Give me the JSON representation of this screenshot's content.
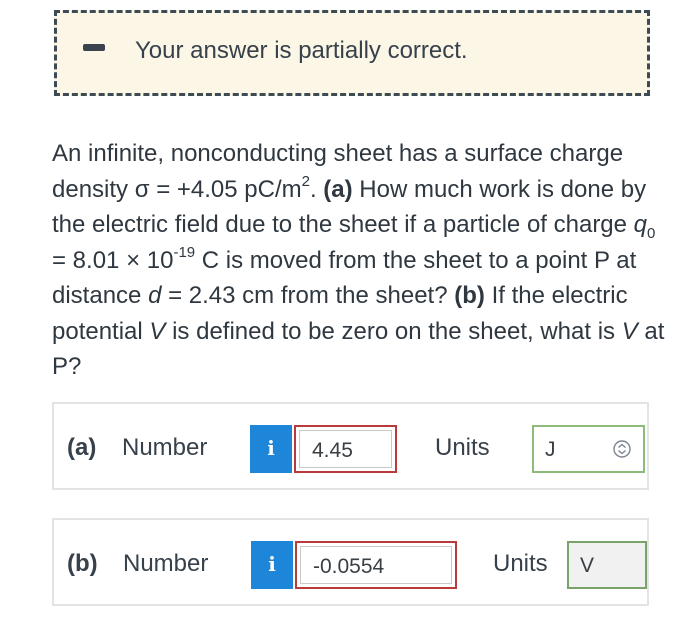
{
  "feedback": {
    "status_text": "Your answer is partially correct.",
    "icon": "minus-icon"
  },
  "question": {
    "t1": "An infinite, nonconducting sheet has a surface charge density σ = +4.05 pC/m",
    "t1_sup": "2",
    "t2": ". ",
    "part_a_tag": "(a)",
    "t3": " How much work is done by the electric field due to the sheet if a particle of charge ",
    "q_symbol": "q",
    "q_sub": "0",
    "t4": " = 8.01 × 10",
    "exp": "-19",
    "t5": " C is moved from the sheet to a point P at distance ",
    "d_symbol": "d",
    "t6": " = 2.43 cm from the sheet? ",
    "part_b_tag": "(b)",
    "t7": " If the electric potential ",
    "v_symbol": "V",
    "t8": " is defined to be zero on the sheet, what is ",
    "v_symbol2": "V",
    "t9": " at P?"
  },
  "answers": [
    {
      "part": "(a)",
      "number_label": "Number",
      "info_glyph": "i",
      "value": "4.45",
      "value_status": "incorrect",
      "units_label": "Units",
      "units_value": "J",
      "units_status": "correct"
    },
    {
      "part": "(b)",
      "number_label": "Number",
      "info_glyph": "i",
      "value": "-0.0554",
      "value_status": "incorrect",
      "units_label": "Units",
      "units_value": "V",
      "units_status": "correct"
    }
  ],
  "colors": {
    "feedback_bg": "#fbf6e6",
    "info_blue": "#1e86d8",
    "incorrect_red": "#b83a3a",
    "correct_green": "#8dbb7a"
  }
}
